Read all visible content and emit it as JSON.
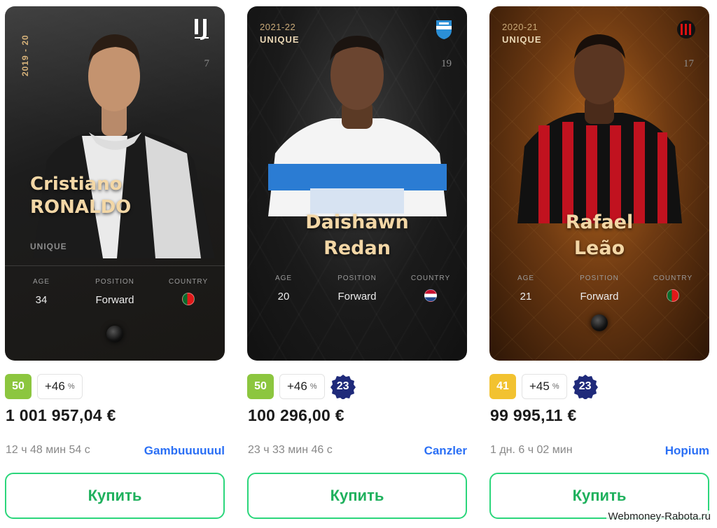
{
  "cards": [
    {
      "season": "2019 - 20",
      "rarity_label": "UNIQUE",
      "shirt_number": "7",
      "club_icon": "juventus-crest-icon",
      "first_name": "Cristiano",
      "last_name": "RONALDO",
      "stats": {
        "age_label": "AGE",
        "age": "34",
        "position_label": "POSITION",
        "position": "Forward",
        "country_label": "COUNTRY",
        "country_flag": "portugal-flag-icon"
      },
      "level": "50",
      "bonus": "+46",
      "bonus_unit": "%",
      "price": "1 001 957,04 €",
      "time_left": "12 ч 48 мин 54 с",
      "seller": "Gambuuuuuul",
      "buy_label": "Купить"
    },
    {
      "season": "2021-22",
      "rarity_label": "UNIQUE",
      "shirt_number": "19",
      "club_icon": "pec-zwolle-crest-icon",
      "first_name": "Daishawn",
      "last_name": "Redan",
      "stats": {
        "age_label": "AGE",
        "age": "20",
        "position_label": "POSITION",
        "position": "Forward",
        "country_label": "COUNTRY",
        "country_flag": "netherlands-flag-icon"
      },
      "level": "50",
      "bonus": "+46",
      "bonus_unit": "%",
      "serial": "23",
      "price": "100 296,00 €",
      "time_left": "23 ч 33 мин 46 с",
      "seller": "Canzler",
      "buy_label": "Купить"
    },
    {
      "season": "2020-21",
      "rarity_label": "UNIQUE",
      "shirt_number": "17",
      "club_icon": "ac-milan-crest-icon",
      "first_name": "Rafael",
      "last_name": "Leão",
      "stats": {
        "age_label": "AGE",
        "age": "21",
        "position_label": "POSITION",
        "position": "Forward",
        "country_label": "COUNTRY",
        "country_flag": "portugal-flag-icon"
      },
      "level": "41",
      "bonus": "+45",
      "bonus_unit": "%",
      "serial": "23",
      "price": "99 995,11 €",
      "time_left": "1 дн. 6 ч 02 мин",
      "seller": "Hopium",
      "buy_label": "Купить"
    }
  ],
  "colors": {
    "level_green": "#8cc63f",
    "level_yellow": "#f2c230",
    "serial_navy": "#1f2a7a",
    "seller_blue": "#2a6ff5",
    "buy_green": "#2bd67b"
  },
  "watermark": "Webmoney-Rabota.ru"
}
